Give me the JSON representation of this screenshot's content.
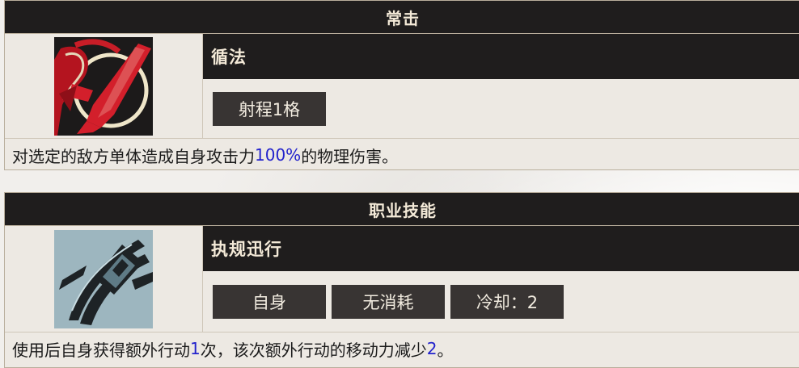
{
  "card1": {
    "header": "常击",
    "skill_name": "循法",
    "tags": [
      "射程1格"
    ],
    "desc": {
      "pre": "对选定的敌方单体造成自身攻击力",
      "num": "100%",
      "post": "的物理伤害。"
    }
  },
  "card2": {
    "header": "职业技能",
    "skill_name": "执规迅行",
    "tags": [
      "自身",
      "无消耗",
      "冷却：2"
    ],
    "desc": {
      "p1": "使用后自身获得额外行动",
      "n1": "1",
      "p2": "次，该次额外行动的移动力减少",
      "n2": "2",
      "p3": "。"
    }
  },
  "colors": {
    "header_bg": "#1f1d1d",
    "tag_bg": "#383433",
    "highlight": "#2222cc",
    "icon1_bg": "#1c1a1a",
    "icon2_bg": "#9db6bf"
  },
  "icons": {
    "card1": "red-blade-skill-icon",
    "card2": "blue-shield-skill-icon"
  }
}
